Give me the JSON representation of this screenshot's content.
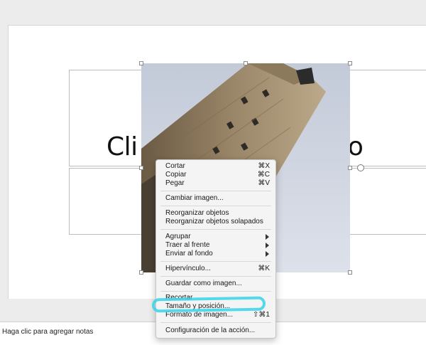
{
  "slide": {
    "title_left": "Cli",
    "title_right": "ulo"
  },
  "notes": {
    "placeholder": "Haga clic para agregar notas"
  },
  "context_menu": {
    "cut": {
      "label": "Cortar",
      "shortcut": "⌘X"
    },
    "copy": {
      "label": "Copiar",
      "shortcut": "⌘C"
    },
    "paste": {
      "label": "Pegar",
      "shortcut": "⌘V"
    },
    "change_image": {
      "label": "Cambiar imagen..."
    },
    "reorganize_objects": {
      "label": "Reorganizar objetos"
    },
    "reorganize_overlapping": {
      "label": "Reorganizar objetos solapados"
    },
    "group": {
      "label": "Agrupar"
    },
    "bring_front": {
      "label": "Traer al frente"
    },
    "send_back": {
      "label": "Enviar al fondo"
    },
    "hyperlink": {
      "label": "Hipervínculo...",
      "shortcut": "⌘K"
    },
    "save_as_image": {
      "label": "Guardar como imagen..."
    },
    "crop": {
      "label": "Recortar"
    },
    "size_position": {
      "label": "Tamaño y posición..."
    },
    "format_image": {
      "label": "Formato de imagen...",
      "shortcut": "⇧⌘1"
    },
    "action_settings": {
      "label": "Configuración de la acción..."
    }
  },
  "colors": {
    "highlight": "#37d4e8",
    "menu_bg": "#f4f4f4"
  }
}
